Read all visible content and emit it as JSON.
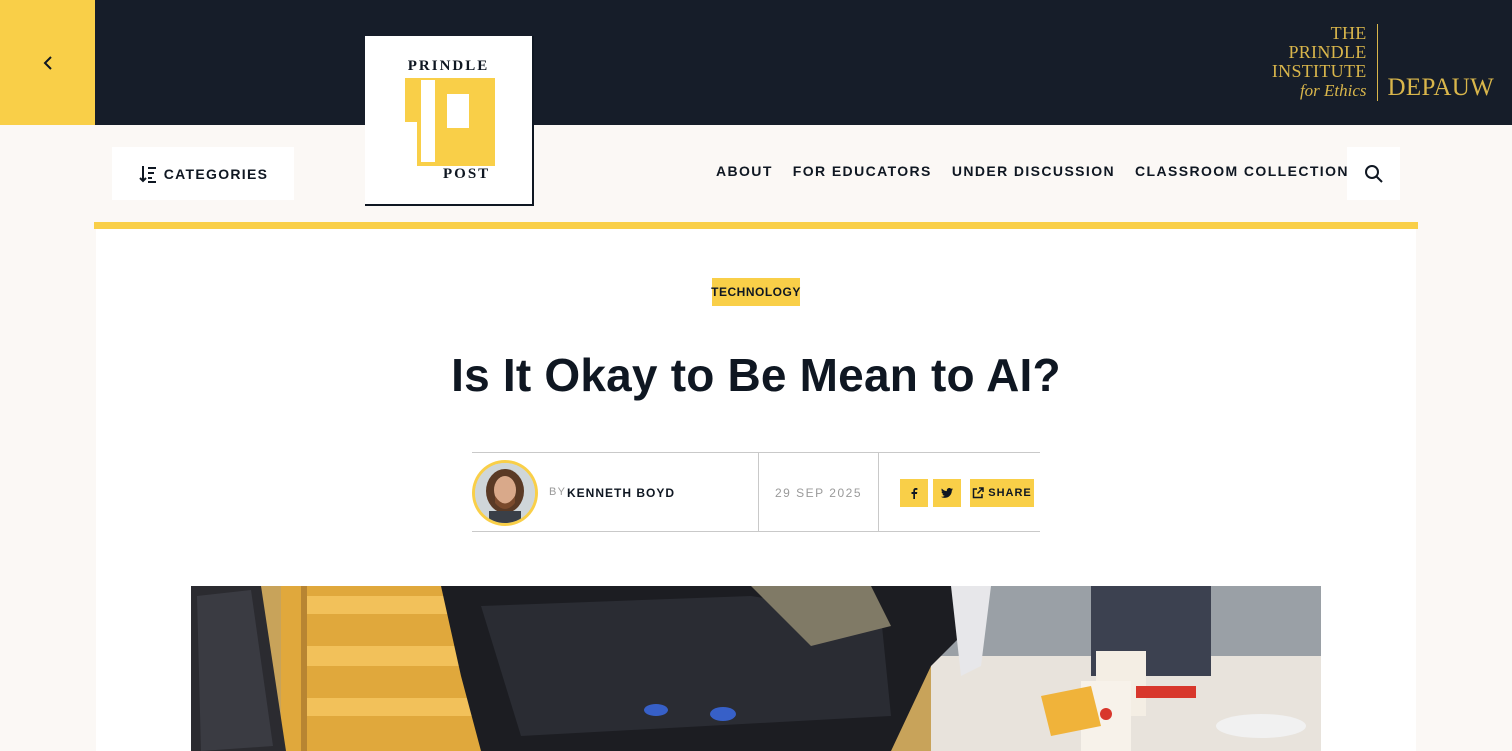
{
  "header": {
    "institute_lines": [
      "THE",
      "PRINDLE",
      "INSTITUTE"
    ],
    "institute_tagline": "for Ethics",
    "university": "DEPAUW",
    "logo_top": "PRINDLE",
    "logo_bottom": "POST",
    "categories_label": "CATEGORIES",
    "nav": [
      "ABOUT",
      "FOR EDUCATORS",
      "UNDER DISCUSSION",
      "CLASSROOM COLLECTIONS"
    ]
  },
  "article": {
    "tag": "TECHNOLOGY",
    "title": "Is It Okay to Be Mean to AI?",
    "by_label": "BY",
    "author": "KENNETH BOYD",
    "date": "29 SEP 2025",
    "share_label": "SHARE"
  },
  "colors": {
    "accent": "#f9cf48",
    "dark": "#161d29",
    "gold_text": "#d9b64b",
    "page_bg": "#fbf8f5"
  },
  "icons": {
    "back": "chevron-left-icon",
    "categories": "sort-list-icon",
    "search": "search-icon",
    "facebook": "facebook-icon",
    "twitter": "twitter-icon",
    "share": "external-share-icon"
  }
}
